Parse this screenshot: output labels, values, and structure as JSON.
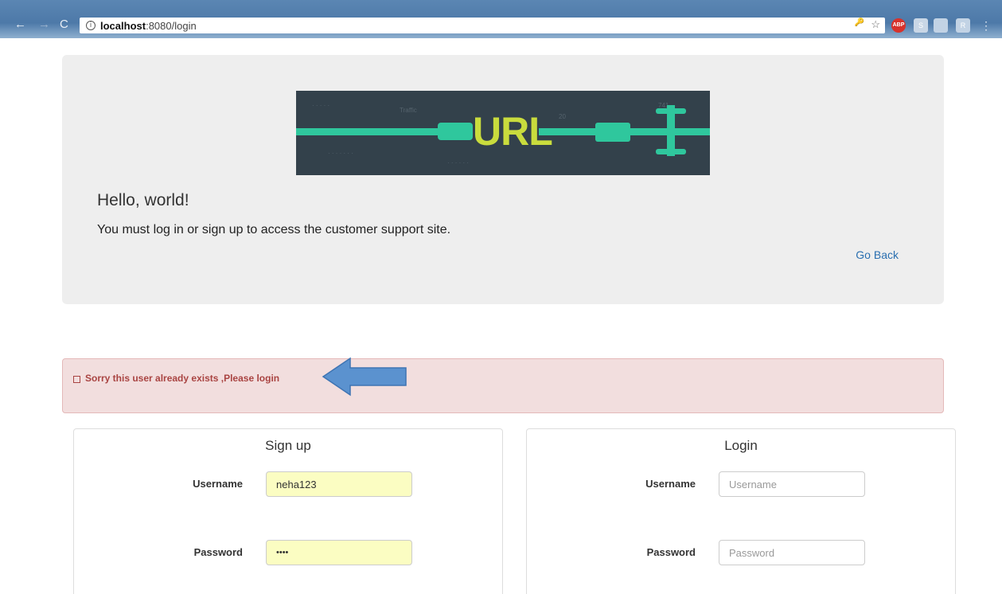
{
  "browser": {
    "address_host": "localhost",
    "address_path": ":8080/login",
    "nav_back": "←",
    "nav_forward": "→",
    "nav_reload": "C",
    "info_glyph": "i",
    "ext_abp": "ABP",
    "ext_s": "S",
    "ext_r": "R",
    "menu_glyph": "⋮",
    "key_glyph": "🔑",
    "star_glyph": "☆"
  },
  "jumbotron": {
    "banner_text": "URL",
    "heading": "Hello, world!",
    "lead": "You must log in or sign up to access the customer support site.",
    "go_back": "Go Back"
  },
  "alert": {
    "message": "Sorry this user already exists ,Please login"
  },
  "signup": {
    "title": "Sign up",
    "username_label": "Username",
    "username_value": "neha123",
    "password_label": "Password",
    "password_value": "••••"
  },
  "login": {
    "title": "Login",
    "username_label": "Username",
    "username_placeholder": "Username",
    "password_label": "Password",
    "password_placeholder": "Password"
  },
  "colors": {
    "alert_bg": "#f2dede",
    "alert_text": "#a94442",
    "link": "#2a6fb0",
    "autofill": "#fbfdc2",
    "arrow": "#5b92cf"
  }
}
